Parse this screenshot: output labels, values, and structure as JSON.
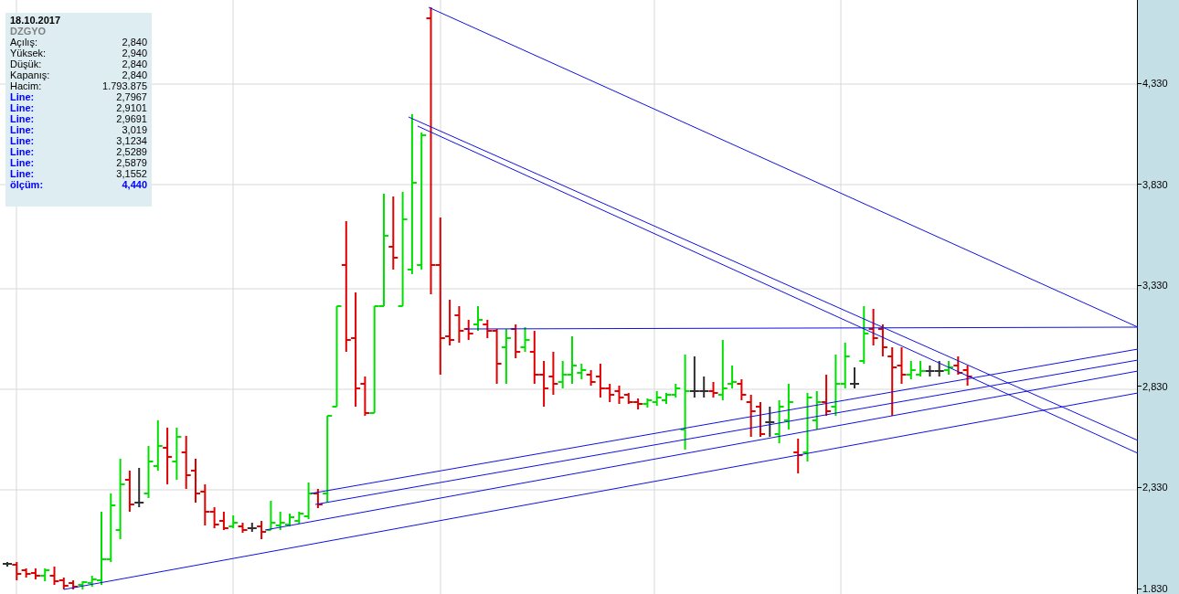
{
  "info_panel": {
    "date": "18.10.2017",
    "symbol": "DZGYO",
    "rows": [
      {
        "kind": "field",
        "label": "Açılış:",
        "value": "2,840"
      },
      {
        "kind": "field",
        "label": "Yüksek:",
        "value": "2,940"
      },
      {
        "kind": "field",
        "label": "Düşük:",
        "value": "2,840"
      },
      {
        "kind": "field",
        "label": "Kapanış:",
        "value": "2,840"
      },
      {
        "kind": "field",
        "label": "Hacim:",
        "value": "1.793.875"
      },
      {
        "kind": "line",
        "label": "Line:",
        "value": "2,7967"
      },
      {
        "kind": "line",
        "label": "Line:",
        "value": "2,9101"
      },
      {
        "kind": "line",
        "label": "Line:",
        "value": "2,9691"
      },
      {
        "kind": "line",
        "label": "Line:",
        "value": "3,019"
      },
      {
        "kind": "line",
        "label": "Line:",
        "value": "3,1234"
      },
      {
        "kind": "line",
        "label": "Line:",
        "value": "2,5289"
      },
      {
        "kind": "line",
        "label": "Line:",
        "value": "2,5879"
      },
      {
        "kind": "line",
        "label": "Line:",
        "value": "3,1552"
      },
      {
        "kind": "measure",
        "label": "ölçüm:",
        "value": "4,440"
      }
    ]
  },
  "price_axis": {
    "ticks": [
      "4,330",
      "3,830",
      "3,330",
      "2,830",
      "2,330",
      "1.830"
    ]
  }
}
